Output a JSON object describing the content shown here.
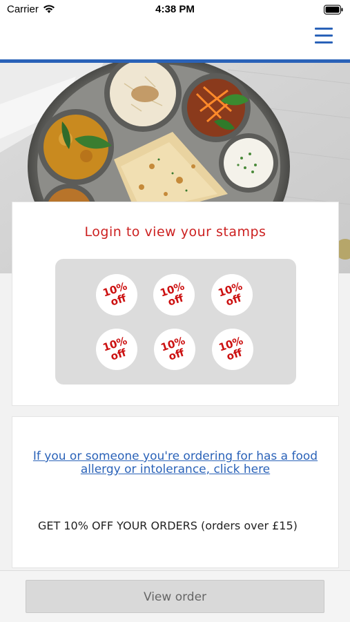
{
  "status_bar": {
    "carrier": "Carrier",
    "time": "4:38 PM"
  },
  "stamps": {
    "title": "Login to view your stamps",
    "items": [
      {
        "label": "10%\noff"
      },
      {
        "label": "10%\noff"
      },
      {
        "label": "10%\noff"
      },
      {
        "label": "10%\noff"
      },
      {
        "label": "10%\noff"
      },
      {
        "label": "10%\noff"
      }
    ]
  },
  "info": {
    "allergy_link": "If you or someone you're ordering for has a food allergy or intolerance, click here",
    "offer": "GET 10% OFF YOUR ORDERS (orders over £15)"
  },
  "footer": {
    "view_order_label": "View order"
  },
  "colors": {
    "accent": "#2a62b8",
    "stamp_red": "#cc1111",
    "title_red": "#cc2020"
  }
}
